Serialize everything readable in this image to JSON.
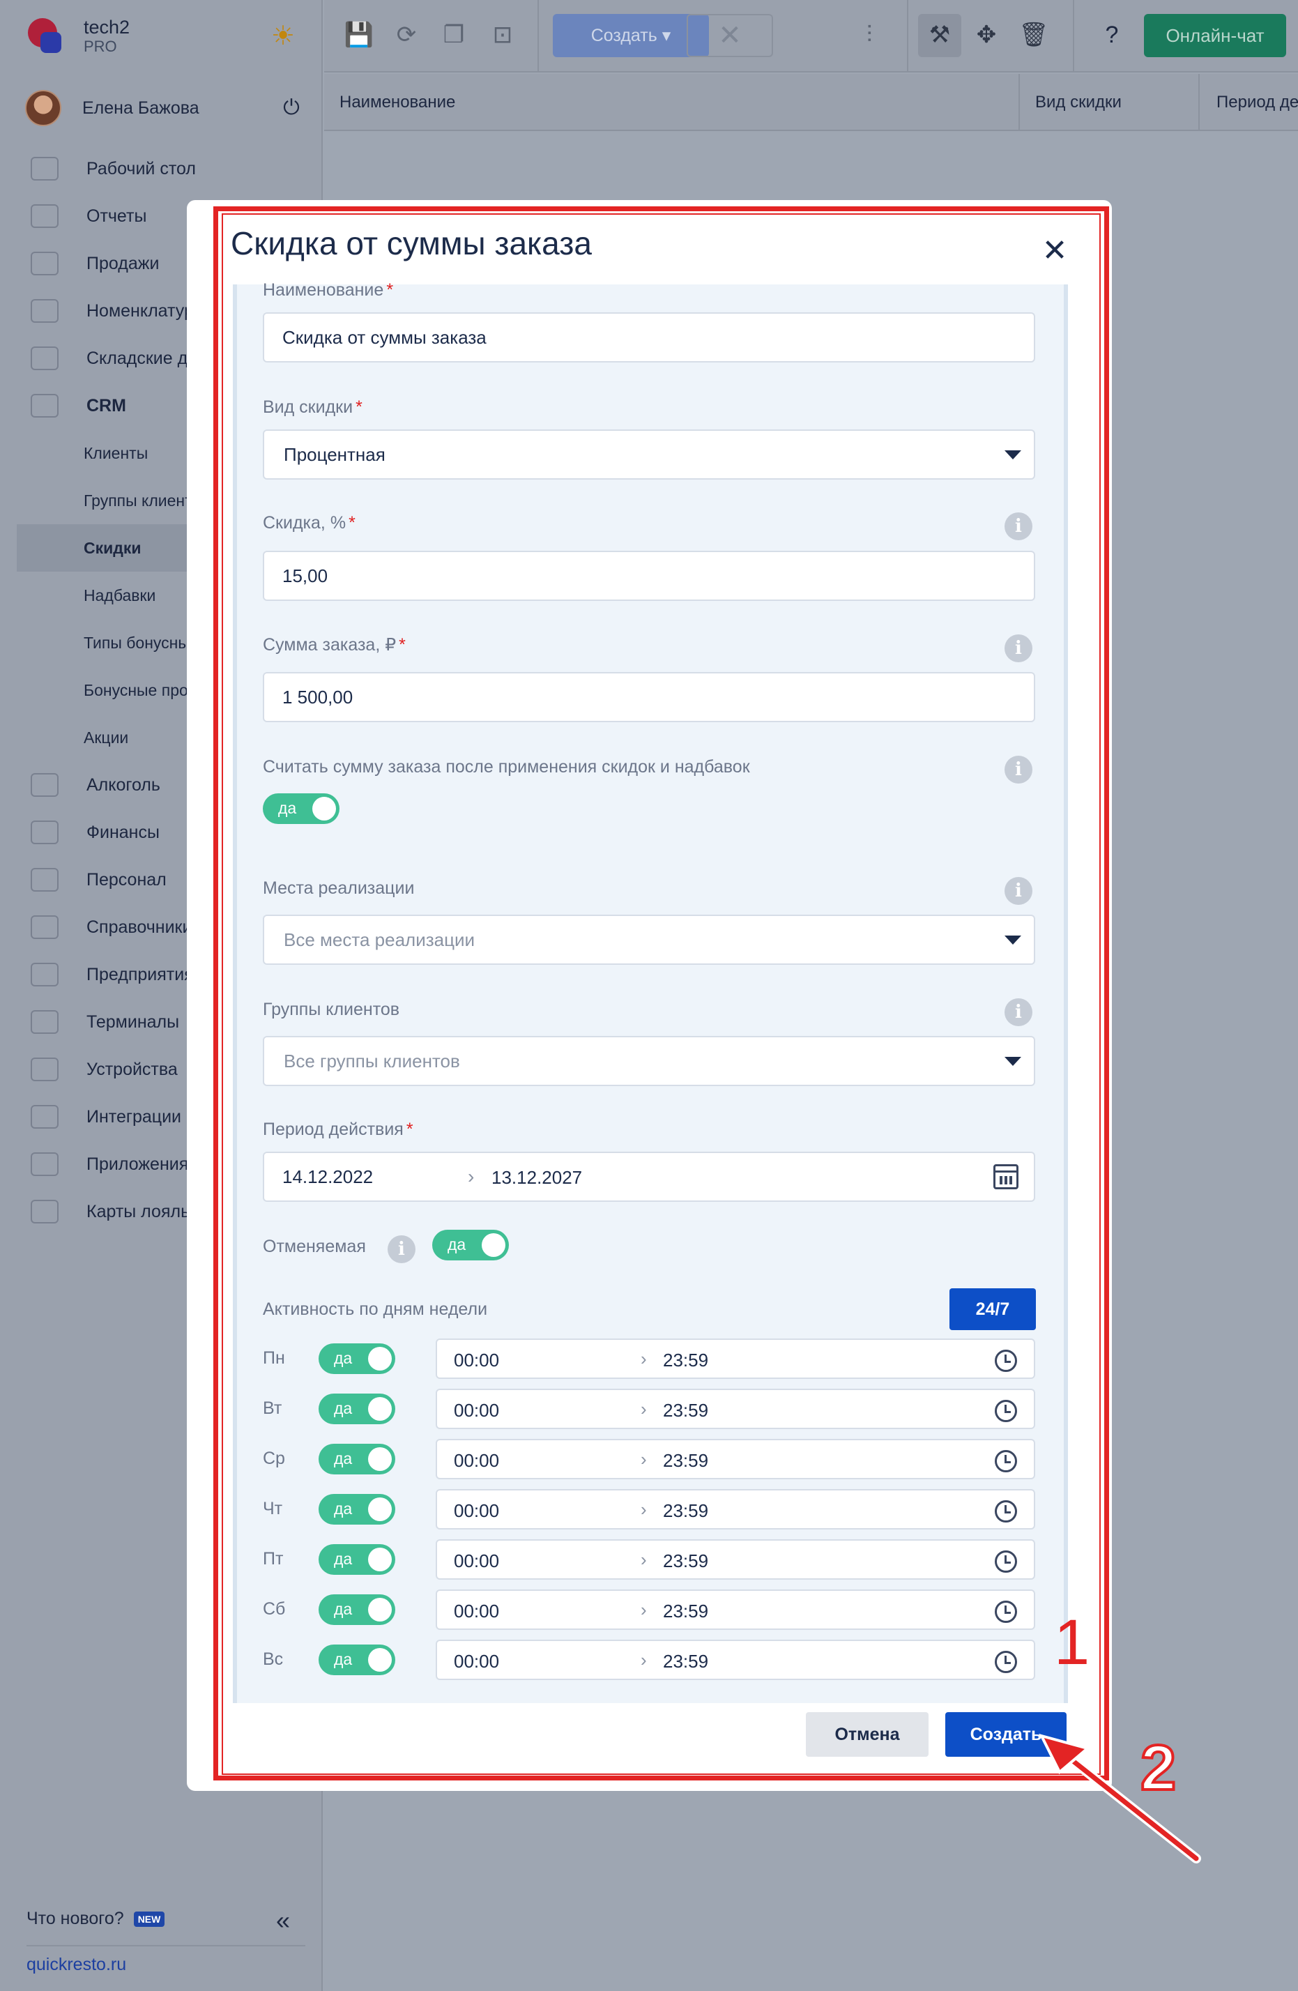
{
  "app": {
    "name": "tech2",
    "plan": "PRO"
  },
  "user": {
    "name": "Елена Бажова"
  },
  "sidebar": {
    "items": [
      {
        "label": "Рабочий стол",
        "icon": "dashboard-icon"
      },
      {
        "label": "Отчеты",
        "icon": "reports-icon"
      },
      {
        "label": "Продажи",
        "icon": "basket-icon"
      },
      {
        "label": "Номенклатура",
        "icon": "tag-icon"
      },
      {
        "label": "Складские документы",
        "icon": "box-icon"
      },
      {
        "label": "CRM",
        "icon": "crm-icon"
      },
      {
        "label": "Алкоголь",
        "icon": "glass-icon"
      },
      {
        "label": "Финансы",
        "icon": "wallet-icon"
      },
      {
        "label": "Персонал",
        "icon": "people-icon"
      },
      {
        "label": "Справочники",
        "icon": "book-icon"
      },
      {
        "label": "Предприятия",
        "icon": "store-icon"
      },
      {
        "label": "Терминалы",
        "icon": "terminal-icon"
      },
      {
        "label": "Устройства",
        "icon": "printer-icon"
      },
      {
        "label": "Интеграции",
        "icon": "infinity-icon"
      },
      {
        "label": "Приложения",
        "icon": "app-icon"
      },
      {
        "label": "Карты лояльности",
        "icon": "card-icon"
      }
    ],
    "crm_sub": [
      "Клиенты",
      "Группы клиентов",
      "Скидки",
      "Надбавки",
      "Типы бонусных программ",
      "Бонусные программы",
      "Акции"
    ],
    "whats_new": "Что нового?",
    "new_badge": "NEW",
    "site": "quickresto.ru"
  },
  "toolbar": {
    "create_label": "Создать",
    "chat_label": "Онлайн-чат"
  },
  "table": {
    "columns": [
      "Наименование",
      "Вид скидки",
      "Период де"
    ]
  },
  "modal": {
    "title": "Скидка от суммы заказа",
    "fields": {
      "name_label": "Наименование",
      "name_value": "Скидка от суммы заказа",
      "type_label": "Вид скидки",
      "type_value": "Процентная",
      "discount_label": "Скидка, %",
      "discount_value": "15,00",
      "sum_label": "Сумма заказа, ₽",
      "sum_value": "1 500,00",
      "after_discounts_label": "Считать сумму заказа после применения скидок и надбавок",
      "after_discounts_toggle": "да",
      "places_label": "Места реализации",
      "places_placeholder": "Все места реализации",
      "groups_label": "Группы клиентов",
      "groups_placeholder": "Все группы клиентов",
      "period_label": "Период действия",
      "period_from": "14.12.2022",
      "period_to": "13.12.2027",
      "cancelable_label": "Отменяемая",
      "cancelable_toggle": "да",
      "weekly_label": "Активность по дням недели",
      "btn_247": "24/7"
    },
    "days": [
      {
        "name": "Пн",
        "toggle": "да",
        "from": "00:00",
        "to": "23:59"
      },
      {
        "name": "Вт",
        "toggle": "да",
        "from": "00:00",
        "to": "23:59"
      },
      {
        "name": "Ср",
        "toggle": "да",
        "from": "00:00",
        "to": "23:59"
      },
      {
        "name": "Чт",
        "toggle": "да",
        "from": "00:00",
        "to": "23:59"
      },
      {
        "name": "Пт",
        "toggle": "да",
        "from": "00:00",
        "to": "23:59"
      },
      {
        "name": "Сб",
        "toggle": "да",
        "from": "00:00",
        "to": "23:59"
      },
      {
        "name": "Вс",
        "toggle": "да",
        "from": "00:00",
        "to": "23:59"
      }
    ],
    "cancel_label": "Отмена",
    "create_label": "Создать"
  },
  "annotations": {
    "marker_1": "1",
    "marker_2": "2"
  },
  "colors": {
    "accent": "#0d4fc7",
    "toggle_on": "#3fbf94",
    "annotation": "#e32424",
    "chat": "#1a7a5c"
  }
}
